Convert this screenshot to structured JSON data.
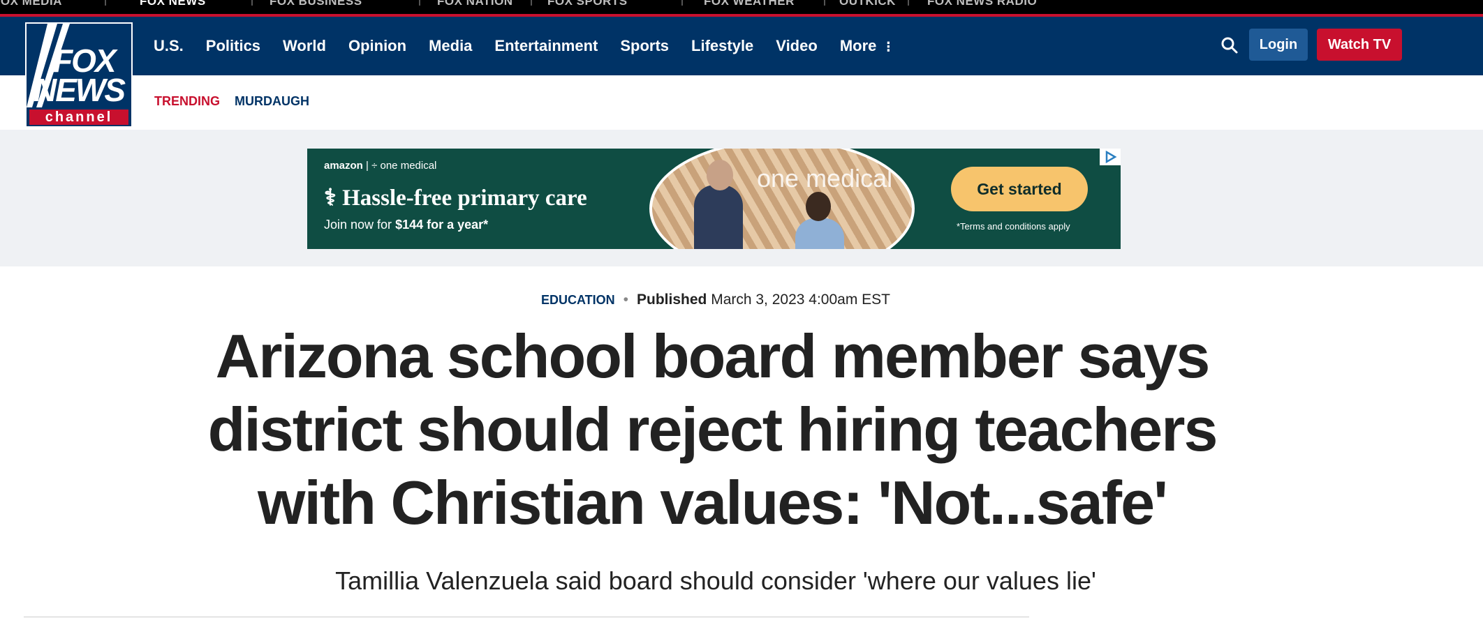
{
  "network_bar": {
    "items": [
      "FOX MEDIA",
      "FOX NEWS",
      "FOX BUSINESS",
      "FOX NATION",
      "FOX SPORTS",
      "FOX WEATHER",
      "OUTKICK",
      "FOX NEWS RADIO"
    ]
  },
  "logo": {
    "line1": "FOX",
    "line2": "NEWS",
    "line3": "channel"
  },
  "nav": {
    "links": [
      "U.S.",
      "Politics",
      "World",
      "Opinion",
      "Media",
      "Entertainment",
      "Sports",
      "Lifestyle",
      "Video",
      "More"
    ],
    "login_label": "Login",
    "watch_label": "Watch TV",
    "search_icon": "search-icon",
    "more_icon": "vertical-dots-icon"
  },
  "trending": {
    "label": "TRENDING",
    "items": [
      "MURDAUGH"
    ]
  },
  "ad": {
    "brand_left": "amazon",
    "brand_right": "one medical",
    "headline": "Hassle-free primary care",
    "sub_prefix": "Join now for ",
    "sub_bold": "$144 for a year*",
    "photo_text": "one medical",
    "cta": "Get started",
    "terms": "*Terms and conditions apply"
  },
  "article": {
    "category": "EDUCATION",
    "published_label": "Published",
    "published_date": "March 3, 2023 4:00am EST",
    "headline": "Arizona school board member says district should reject hiring teachers with Christian values: 'Not...safe'",
    "subheadline": "Tamillia Valenzuela said board should consider 'where our values lie'"
  },
  "colors": {
    "navy": "#003366",
    "red": "#c8102e",
    "ad_green": "#0f4d43",
    "ad_cta": "#f7c46c"
  }
}
